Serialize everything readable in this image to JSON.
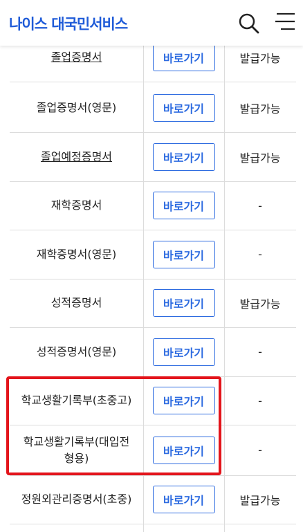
{
  "header": {
    "logo": "나이스 대국민서비스",
    "search_icon": "search-icon",
    "menu_icon": "hamburger-menu-icon"
  },
  "colors": {
    "brand": "#1f5bd8",
    "button_accent": "#2d6be0",
    "highlight": "#e3141b"
  },
  "rows": [
    {
      "name": "졸업증명서",
      "linked": true,
      "button": "바로가기",
      "status": "발급가능"
    },
    {
      "name": "졸업증명서(영문)",
      "linked": false,
      "button": "바로가기",
      "status": "발급가능"
    },
    {
      "name": "졸업예정증명서",
      "linked": true,
      "button": "바로가기",
      "status": "발급가능"
    },
    {
      "name": "재학증명서",
      "linked": false,
      "button": "바로가기",
      "status": "-"
    },
    {
      "name": "재학증명서(영문)",
      "linked": false,
      "button": "바로가기",
      "status": "-"
    },
    {
      "name": "성적증명서",
      "linked": false,
      "button": "바로가기",
      "status": "발급가능"
    },
    {
      "name": "성적증명서(영문)",
      "linked": false,
      "button": "바로가기",
      "status": "-"
    },
    {
      "name": "학교생활기록부(초중고)",
      "linked": false,
      "button": "바로가기",
      "status": "-"
    },
    {
      "name": "학교생활기록부(대입전\n형용)",
      "linked": false,
      "button": "바로가기",
      "status": "-"
    },
    {
      "name": "정원외관리증명서(초중)",
      "linked": false,
      "button": "바로가기",
      "status": "발급가능"
    }
  ]
}
